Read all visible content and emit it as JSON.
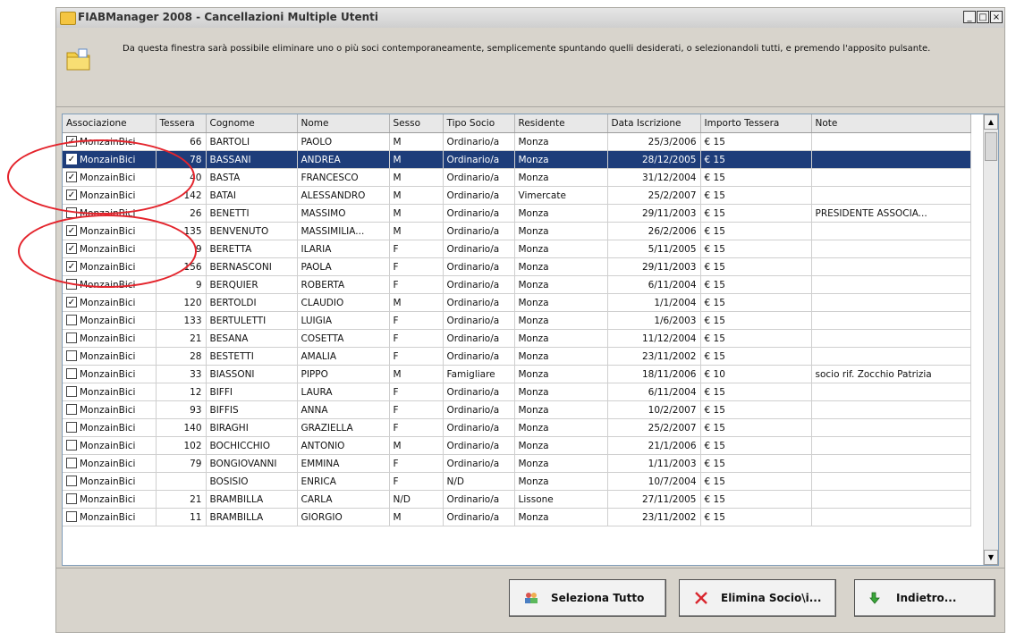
{
  "window": {
    "title": "FIABManager 2008 - Cancellazioni Multiple Utenti",
    "min_label": "_",
    "max_label": "□",
    "close_label": "×"
  },
  "description": "Da questa finestra sarà possibile eliminare uno o più soci contemporaneamente, semplicemente spuntando quelli desiderati, o selezionandoli tutti, e premendo l'apposito pulsante.",
  "table": {
    "columns": [
      "Associazione",
      "Tessera",
      "Cognome",
      "Nome",
      "Sesso",
      "Tipo Socio",
      "Residente",
      "Data Iscrizione",
      "Importo Tessera",
      "Note"
    ],
    "rows": [
      {
        "checked": true,
        "selected": false,
        "cells": [
          "MonzainBici",
          "66",
          "BARTOLI",
          "PAOLO",
          "M",
          "Ordinario/a",
          "Monza",
          "25/3/2006",
          "€ 15",
          ""
        ]
      },
      {
        "checked": true,
        "selected": true,
        "cells": [
          "MonzainBici",
          "78",
          "BASSANI",
          "ANDREA",
          "M",
          "Ordinario/a",
          "Monza",
          "28/12/2005",
          "€ 15",
          ""
        ]
      },
      {
        "checked": true,
        "selected": false,
        "cells": [
          "MonzainBici",
          "40",
          "BASTA",
          "FRANCESCO",
          "M",
          "Ordinario/a",
          "Monza",
          "31/12/2004",
          "€ 15",
          ""
        ]
      },
      {
        "checked": true,
        "selected": false,
        "cells": [
          "MonzainBici",
          "142",
          "BATAI",
          "ALESSANDRO",
          "M",
          "Ordinario/a",
          "Vimercate",
          "25/2/2007",
          "€ 15",
          ""
        ]
      },
      {
        "checked": false,
        "selected": false,
        "cells": [
          "MonzainBici",
          "26",
          "BENETTI",
          "MASSIMO",
          "M",
          "Ordinario/a",
          "Monza",
          "29/11/2003",
          "€ 15",
          "PRESIDENTE ASSOCIA..."
        ]
      },
      {
        "checked": true,
        "selected": false,
        "cells": [
          "MonzainBici",
          "135",
          "BENVENUTO",
          "MASSIMILIA...",
          "M",
          "Ordinario/a",
          "Monza",
          "26/2/2006",
          "€ 15",
          ""
        ]
      },
      {
        "checked": true,
        "selected": false,
        "cells": [
          "MonzainBici",
          "9",
          "BERETTA",
          "ILARIA",
          "F",
          "Ordinario/a",
          "Monza",
          "5/11/2005",
          "€ 15",
          ""
        ]
      },
      {
        "checked": true,
        "selected": false,
        "cells": [
          "MonzainBici",
          "156",
          "BERNASCONI",
          "PAOLA",
          "F",
          "Ordinario/a",
          "Monza",
          "29/11/2003",
          "€ 15",
          ""
        ]
      },
      {
        "checked": false,
        "selected": false,
        "cells": [
          "MonzainBici",
          "9",
          "BERQUIER",
          "ROBERTA",
          "F",
          "Ordinario/a",
          "Monza",
          "6/11/2004",
          "€ 15",
          ""
        ]
      },
      {
        "checked": true,
        "selected": false,
        "cells": [
          "MonzainBici",
          "120",
          "BERTOLDI",
          "CLAUDIO",
          "M",
          "Ordinario/a",
          "Monza",
          "1/1/2004",
          "€ 15",
          ""
        ]
      },
      {
        "checked": false,
        "selected": false,
        "cells": [
          "MonzainBici",
          "133",
          "BERTULETTI",
          "LUIGIA",
          "F",
          "Ordinario/a",
          "Monza",
          "1/6/2003",
          "€ 15",
          ""
        ]
      },
      {
        "checked": false,
        "selected": false,
        "cells": [
          "MonzainBici",
          "21",
          "BESANA",
          "COSETTA",
          "F",
          "Ordinario/a",
          "Monza",
          "11/12/2004",
          "€ 15",
          ""
        ]
      },
      {
        "checked": false,
        "selected": false,
        "cells": [
          "MonzainBici",
          "28",
          "BESTETTI",
          "AMALIA",
          "F",
          "Ordinario/a",
          "Monza",
          "23/11/2002",
          "€ 15",
          ""
        ]
      },
      {
        "checked": false,
        "selected": false,
        "cells": [
          "MonzainBici",
          "33",
          "BIASSONI",
          "PIPPO",
          "M",
          "Famigliare",
          "Monza",
          "18/11/2006",
          "€ 10",
          "socio rif. Zocchio Patrizia"
        ]
      },
      {
        "checked": false,
        "selected": false,
        "cells": [
          "MonzainBici",
          "12",
          "BIFFI",
          "LAURA",
          "F",
          "Ordinario/a",
          "Monza",
          "6/11/2004",
          "€ 15",
          ""
        ]
      },
      {
        "checked": false,
        "selected": false,
        "cells": [
          "MonzainBici",
          "93",
          "BIFFIS",
          "ANNA",
          "F",
          "Ordinario/a",
          "Monza",
          "10/2/2007",
          "€ 15",
          ""
        ]
      },
      {
        "checked": false,
        "selected": false,
        "cells": [
          "MonzainBici",
          "140",
          "BIRAGHI",
          "GRAZIELLA",
          "F",
          "Ordinario/a",
          "Monza",
          "25/2/2007",
          "€ 15",
          ""
        ]
      },
      {
        "checked": false,
        "selected": false,
        "cells": [
          "MonzainBici",
          "102",
          "BOCHICCHIO",
          "ANTONIO",
          "M",
          "Ordinario/a",
          "Monza",
          "21/1/2006",
          "€ 15",
          ""
        ]
      },
      {
        "checked": false,
        "selected": false,
        "cells": [
          "MonzainBici",
          "79",
          "BONGIOVANNI",
          "EMMINA",
          "F",
          "Ordinario/a",
          "Monza",
          "1/11/2003",
          "€ 15",
          ""
        ]
      },
      {
        "checked": false,
        "selected": false,
        "cells": [
          "MonzainBici",
          "",
          "BOSISIO",
          "ENRICA",
          "F",
          "N/D",
          "Monza",
          "10/7/2004",
          "€ 15",
          ""
        ]
      },
      {
        "checked": false,
        "selected": false,
        "cells": [
          "MonzainBici",
          "21",
          "BRAMBILLA",
          "CARLA",
          "N/D",
          "Ordinario/a",
          "Lissone",
          "27/11/2005",
          "€ 15",
          ""
        ]
      },
      {
        "checked": false,
        "selected": false,
        "cells": [
          "MonzainBici",
          "11",
          "BRAMBILLA",
          "GIORGIO",
          "M",
          "Ordinario/a",
          "Monza",
          "23/11/2002",
          "€ 15",
          ""
        ]
      }
    ]
  },
  "buttons": {
    "select_all": "Seleziona Tutto",
    "delete": "Elimina Socio\\i...",
    "back": "Indietro..."
  },
  "colors": {
    "selection": "#1e3d7a",
    "annotation_circle": "#e4242c"
  }
}
